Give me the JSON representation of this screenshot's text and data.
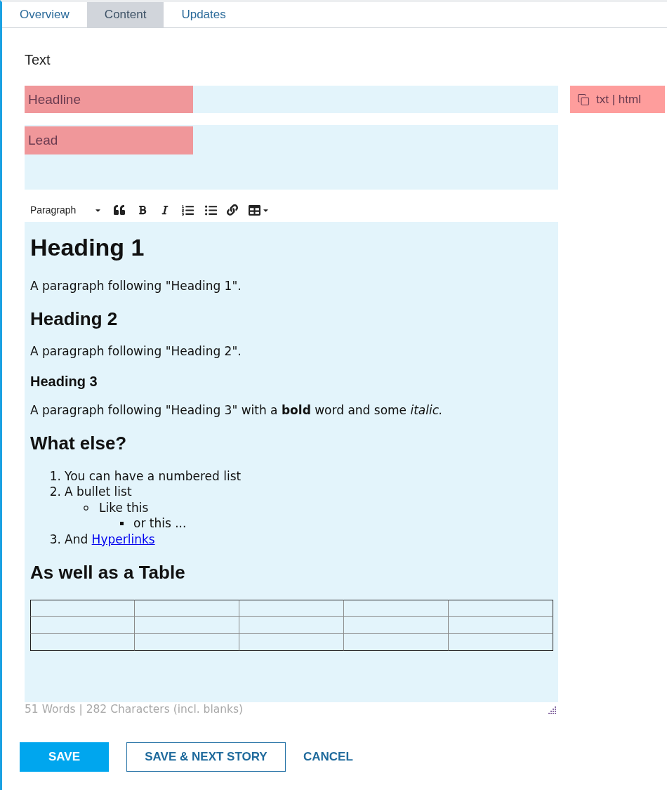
{
  "tabs": [
    {
      "label": "Overview",
      "selected": false
    },
    {
      "label": "Content",
      "selected": true
    },
    {
      "label": "Updates",
      "selected": false
    }
  ],
  "section_title": "Text",
  "headline": {
    "label": "Headline"
  },
  "format_toggle": {
    "label": "txt | html"
  },
  "lead": {
    "label": "Lead"
  },
  "editor": {
    "block_format": "Paragraph",
    "content": [
      {
        "kind": "h1",
        "text": "Heading 1"
      },
      {
        "kind": "p",
        "text": "A paragraph following \"Heading 1\"."
      },
      {
        "kind": "h2",
        "text": "Heading 2"
      },
      {
        "kind": "p",
        "text": "A paragraph following \"Heading 2\"."
      },
      {
        "kind": "h3",
        "text": "Heading 3"
      },
      {
        "kind": "p",
        "text": "A paragraph following \"Heading 3\" with a **bold** word and some *italic.*"
      },
      {
        "kind": "h2",
        "text": "What else?"
      },
      {
        "kind": "ol",
        "items": [
          {
            "marker": "1.",
            "text": "You can have a numbered list"
          },
          {
            "marker": "2.",
            "text": "A bullet list",
            "children": [
              {
                "text": "Like this",
                "children": [
                  {
                    "text": "or this ..."
                  }
                ]
              }
            ]
          },
          {
            "marker": "3.",
            "text": "And",
            "link": "Hyperlinks"
          }
        ]
      },
      {
        "kind": "h2",
        "text": "As well as a Table"
      },
      {
        "kind": "table"
      }
    ],
    "status": "51 Words | 282 Characters (incl. blanks)"
  },
  "actions": [
    {
      "label": "SAVE",
      "kind": "primary"
    },
    {
      "label": "SAVE & NEXT STORY",
      "kind": "secondary"
    },
    {
      "label": "CANCEL",
      "kind": "link"
    }
  ]
}
